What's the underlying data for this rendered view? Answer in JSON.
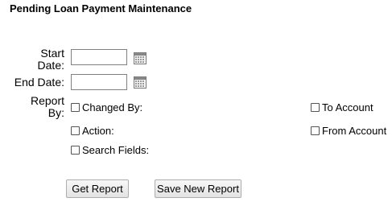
{
  "page": {
    "title": "Pending Loan Payment Maintenance"
  },
  "form": {
    "start_date_label": "Start\nDate:",
    "start_date_value": "",
    "end_date_label": "End Date:",
    "end_date_value": "",
    "report_by_label": "Report\nBy:",
    "calendar_icon": "calendar-icon",
    "report_by_options": {
      "changed_by": "Changed By:",
      "action": "Action:",
      "search_fields": "Search Fields:",
      "to_account": "To Account",
      "from_account": "From Account"
    }
  },
  "buttons": {
    "get_report": "Get Report",
    "save_new_report": "Save New Report"
  }
}
